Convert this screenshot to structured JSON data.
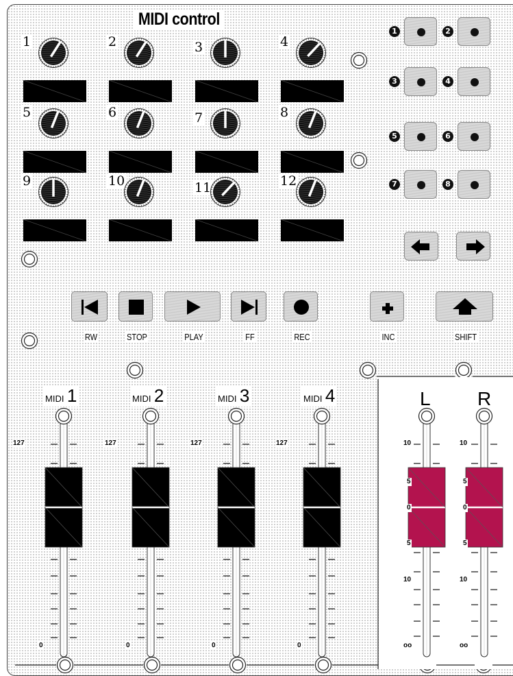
{
  "title": "MIDI control",
  "knobs": [
    {
      "number": "1",
      "value": 0.62
    },
    {
      "number": "2",
      "value": 0.62
    },
    {
      "number": "3",
      "value": 0.5
    },
    {
      "number": "4",
      "value": 0.66
    },
    {
      "number": "5",
      "value": 0.58
    },
    {
      "number": "6",
      "value": 0.58
    },
    {
      "number": "7",
      "value": 0.5
    },
    {
      "number": "8",
      "value": 0.58
    },
    {
      "number": "9",
      "value": 0.5
    },
    {
      "number": "10",
      "value": 0.58
    },
    {
      "number": "11",
      "value": 0.66
    },
    {
      "number": "12",
      "value": 0.58
    }
  ],
  "pads": [
    "1",
    "2",
    "3",
    "4",
    "5",
    "6",
    "7",
    "8"
  ],
  "nav_buttons": {
    "left": "arrow-left-icon",
    "right": "arrow-right-icon"
  },
  "transport": {
    "rw": "RW",
    "stop": "STOP",
    "play": "PLAY",
    "ff": "FF",
    "rec": "REC",
    "inc": "INC",
    "shift": "SHIFT"
  },
  "midi_faders": [
    {
      "prefix": "MIDI",
      "number": "1",
      "value": 0.46
    },
    {
      "prefix": "MIDI",
      "number": "2",
      "value": 0.46
    },
    {
      "prefix": "MIDI",
      "number": "3",
      "value": 0.46
    },
    {
      "prefix": "MIDI",
      "number": "4",
      "value": 0.46
    }
  ],
  "midi_scale": {
    "top": "127",
    "bottom": "0"
  },
  "vu_faders": [
    {
      "label": "L",
      "value": 0.0
    },
    {
      "label": "R",
      "value": 0.0
    }
  ],
  "vu_scale": [
    "10",
    "5",
    "0",
    "5",
    "10",
    "oo"
  ],
  "colors": {
    "fader_cap_vu": "#b3134e",
    "fader_cap_midi": "#000000",
    "pad_led": "#111111"
  }
}
